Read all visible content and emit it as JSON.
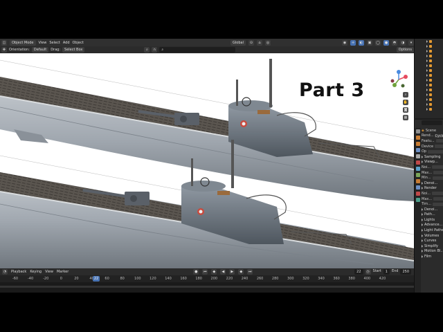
{
  "header": {
    "mode": "Object Mode",
    "menus": [
      "View",
      "Select",
      "Add",
      "Object"
    ],
    "orientation_label": "Orientation:",
    "orientation_value": "Default",
    "drag_label": "Drag:",
    "drag_value": "Select Box",
    "transform_space": "Global",
    "options_label": "Options"
  },
  "viewport": {
    "overlay_text": "Part 3"
  },
  "timeline": {
    "menus": [
      "Playback",
      "Keying",
      "View",
      "Marker"
    ],
    "ticks": [
      "-60",
      "-40",
      "-20",
      "0",
      "20",
      "40",
      "60",
      "80",
      "100",
      "120",
      "140",
      "160",
      "180",
      "200",
      "220",
      "240",
      "260",
      "280",
      "300",
      "320",
      "340",
      "360",
      "380",
      "400",
      "420"
    ],
    "current_frame": "22",
    "current_frame_marker": "22",
    "start_label": "Start",
    "start_value": "1",
    "end_label": "End",
    "end_value": "250"
  },
  "properties": {
    "scene_label": "Scene",
    "rows": [
      {
        "label": "Rend...",
        "value": "Cycles",
        "type": "field"
      },
      {
        "label": "Featu...",
        "value": "",
        "type": "field"
      },
      {
        "label": "Device",
        "value": "",
        "type": "field"
      },
      {
        "label": "Op",
        "value": "",
        "type": "field"
      },
      {
        "label": "Sampling",
        "value": "",
        "type": "section"
      },
      {
        "label": "Viewp...",
        "value": "",
        "type": "section"
      },
      {
        "label": "Noi...",
        "value": "",
        "type": "field"
      },
      {
        "label": "Max...",
        "value": "",
        "type": "field"
      },
      {
        "label": "Min...",
        "value": "",
        "type": "field"
      },
      {
        "label": "Denoi...",
        "value": "",
        "type": "section"
      },
      {
        "label": "Render",
        "value": "",
        "type": "section"
      },
      {
        "label": "Noi...",
        "value": "",
        "type": "field"
      },
      {
        "label": "Max...",
        "value": "",
        "type": "field"
      },
      {
        "label": "Tim...",
        "value": "",
        "type": "field"
      },
      {
        "label": "Denoi...",
        "value": "",
        "type": "section"
      },
      {
        "label": "Path...",
        "value": "",
        "type": "section"
      },
      {
        "label": "Lights",
        "value": "",
        "type": "section"
      },
      {
        "label": "Advance...",
        "value": "",
        "type": "section"
      },
      {
        "label": "Light Paths",
        "value": "",
        "type": "section"
      },
      {
        "label": "Volumes",
        "value": "",
        "type": "section"
      },
      {
        "label": "Curves",
        "value": "",
        "type": "section"
      },
      {
        "label": "Simplify",
        "value": "",
        "type": "section"
      },
      {
        "label": "Motion Bl...",
        "value": "",
        "type": "section"
      },
      {
        "label": "Film",
        "value": "",
        "type": "section"
      }
    ]
  },
  "colors": {
    "accent": "#4772b3",
    "hull": "#9ea6ae",
    "deck": "#5b5650",
    "viewport_bg": "#ffffff"
  }
}
